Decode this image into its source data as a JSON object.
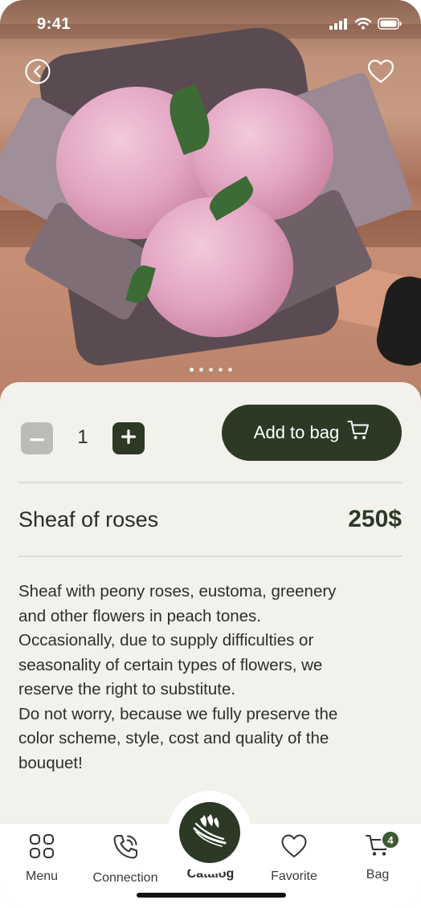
{
  "status_bar": {
    "time": "9:41"
  },
  "hero": {
    "back_icon": "chevron-left-circle-icon",
    "favorite_icon": "heart-outline-icon",
    "carousel": {
      "total": 5,
      "active": 1
    }
  },
  "quantity": {
    "value": "1",
    "minus_label": "−",
    "plus_label": "+"
  },
  "add_to_bag": {
    "label": "Add to bag",
    "icon": "cart-icon"
  },
  "product": {
    "title": "Sheaf of roses",
    "price": "250$",
    "description": "Sheaf with peony roses, eustoma, greenery\nand other flowers in peach tones.\nOccasionally, due to supply difficulties or\nseasonality of certain types of flowers, we\nreserve the right to substitute.\nDo not worry, because we fully preserve the\ncolor scheme, style, cost and quality of the\nbouquet!"
  },
  "tabbar": {
    "items": [
      {
        "label": "Menu",
        "icon": "grid-icon"
      },
      {
        "label": "Connection",
        "icon": "phone-icon"
      },
      {
        "label": "Catalog",
        "icon": "bouquet-icon",
        "active": true
      },
      {
        "label": "Favorite",
        "icon": "heart-icon"
      },
      {
        "label": "Bag",
        "icon": "cart-icon",
        "badge": "4"
      }
    ]
  },
  "colors": {
    "accent": "#2c3a25",
    "background": "#f3f1ec",
    "minus_button": "#b9bdb5",
    "badge": "#3e5a34"
  }
}
